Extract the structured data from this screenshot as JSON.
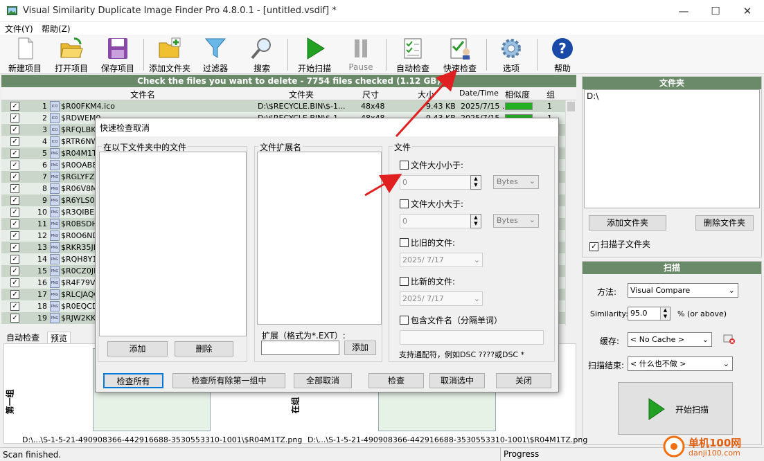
{
  "window": {
    "title": "Visual Similarity Duplicate Image Finder Pro 4.8.0.1 - [untitled.vsdif] *",
    "minimize": "—",
    "maximize": "☐",
    "close": "✕"
  },
  "menu": [
    "文件(Y)",
    "帮助(Z)"
  ],
  "toolbar": {
    "new": "新建项目",
    "open": "打开项目",
    "save": "保存项目",
    "add_folder": "添加文件夹",
    "filter": "过滤器",
    "search": "搜索",
    "start": "开始扫描",
    "pause": "Pause",
    "auto_check": "自动检查",
    "quick_check": "快速检查",
    "options": "选项",
    "help": "帮助"
  },
  "grid": {
    "banner": "Check the files you want to delete - 7754 files checked (1.12 GB)",
    "columns": [
      "文件名",
      "文件夹",
      "尺寸",
      "大小",
      "Date/Time",
      "相似度",
      "组"
    ],
    "rows": [
      {
        "n": "1",
        "name": "$R00FKM4.ico",
        "icon": "ICO",
        "folder": "D:\\$RECYCLE.BIN\\$-1...",
        "size": "48x48",
        "kb": "9.43 KB",
        "dt": "2025/7/15 ...",
        "sim": 100,
        "grp": "1"
      },
      {
        "n": "2",
        "name": "$RDWEM0...",
        "icon": "ICO",
        "folder": "D:\\$RECYCLE.BIN\\$-1...",
        "size": "48x48",
        "kb": "9.43 KB",
        "dt": "2025/7/15 ...",
        "sim": 100,
        "grp": "1"
      },
      {
        "n": "3",
        "name": "$RFQLBKF...",
        "icon": "ICO",
        "folder": "",
        "size": "",
        "kb": "",
        "dt": "",
        "sim": 0,
        "grp": ""
      },
      {
        "n": "4",
        "name": "$RTR6NW...",
        "icon": "ICO",
        "folder": "",
        "size": "",
        "kb": "",
        "dt": "",
        "sim": 0,
        "grp": ""
      },
      {
        "n": "5",
        "name": "$R04M1TZ...",
        "icon": "PNG",
        "folder": "",
        "size": "",
        "kb": "",
        "dt": "",
        "sim": 0,
        "grp": ""
      },
      {
        "n": "6",
        "name": "$R0OAB8X...",
        "icon": "PNG",
        "folder": "",
        "size": "",
        "kb": "",
        "dt": "",
        "sim": 0,
        "grp": ""
      },
      {
        "n": "7",
        "name": "$RGLYFZH...",
        "icon": "PNG",
        "folder": "",
        "size": "",
        "kb": "",
        "dt": "",
        "sim": 0,
        "grp": ""
      },
      {
        "n": "8",
        "name": "$R06V8M3...",
        "icon": "PNG",
        "folder": "",
        "size": "",
        "kb": "",
        "dt": "",
        "sim": 0,
        "grp": ""
      },
      {
        "n": "9",
        "name": "$R6YLS0Q...",
        "icon": "PNG",
        "folder": "",
        "size": "",
        "kb": "",
        "dt": "",
        "sim": 0,
        "grp": ""
      },
      {
        "n": "10",
        "name": "$R3QIBE2...",
        "icon": "PNG",
        "folder": "",
        "size": "",
        "kb": "",
        "dt": "",
        "sim": 0,
        "grp": ""
      },
      {
        "n": "11",
        "name": "$R0BSDH5...",
        "icon": "PNG",
        "folder": "",
        "size": "",
        "kb": "",
        "dt": "",
        "sim": 0,
        "grp": ""
      },
      {
        "n": "12",
        "name": "$R0O6ND8...",
        "icon": "PNG",
        "folder": "",
        "size": "",
        "kb": "",
        "dt": "",
        "sim": 0,
        "grp": ""
      },
      {
        "n": "13",
        "name": "$RKR35JK...",
        "icon": "PNG",
        "folder": "",
        "size": "",
        "kb": "",
        "dt": "",
        "sim": 0,
        "grp": ""
      },
      {
        "n": "14",
        "name": "$RQH8Y19...",
        "icon": "PNG",
        "folder": "",
        "size": "",
        "kb": "",
        "dt": "",
        "sim": 0,
        "grp": ""
      },
      {
        "n": "15",
        "name": "$R0CZ0JN...",
        "icon": "PNG",
        "folder": "",
        "size": "",
        "kb": "",
        "dt": "",
        "sim": 0,
        "grp": ""
      },
      {
        "n": "16",
        "name": "$R4F79VA...",
        "icon": "PNG",
        "folder": "",
        "size": "",
        "kb": "",
        "dt": "",
        "sim": 0,
        "grp": ""
      },
      {
        "n": "17",
        "name": "$RLCJAQQ...",
        "icon": "PNG",
        "folder": "",
        "size": "",
        "kb": "",
        "dt": "",
        "sim": 0,
        "grp": ""
      },
      {
        "n": "18",
        "name": "$R0EQCD1...",
        "icon": "PNG",
        "folder": "",
        "size": "",
        "kb": "",
        "dt": "",
        "sim": 0,
        "grp": ""
      },
      {
        "n": "19",
        "name": "$RJW2KKE...",
        "icon": "PNG",
        "folder": "",
        "size": "",
        "kb": "",
        "dt": "",
        "sim": 0,
        "grp": ""
      }
    ]
  },
  "lower": {
    "tab_auto": "自动检查",
    "tab_preview": "预览",
    "group_left": "第一组",
    "group_right": "在组",
    "path_left": "D:\\...\\S-1-5-21-490908366-442916688-3530553310-1001\\$R04M1TZ.png",
    "path_right": "D:\\...\\S-1-5-21-490908366-442916688-3530553310-1001\\$R04M1TZ.png"
  },
  "status": {
    "left": "Scan finished.",
    "progress": "Progress"
  },
  "folders_panel": {
    "title": "文件夹",
    "item": "D:\\",
    "add": "添加文件夹",
    "remove": "删除文件夹",
    "subfolders": "扫描子文件夹"
  },
  "scan_panel": {
    "title": "扫描",
    "method_label": "方法:",
    "method_value": "Visual Compare",
    "similarity_label": "Similarity:",
    "similarity_value": "95.0",
    "similarity_unit": "% (or above)",
    "cache_label": "缓存:",
    "cache_value": "< No Cache >",
    "end_label": "扫描结束:",
    "end_value": "< 什么也不做 >",
    "start": "开始扫描"
  },
  "dialog": {
    "title": "快速检查取消",
    "folders_group": "在以下文件夹中的文件",
    "ext_group": "文件扩展名",
    "ext_label": "扩展（格式为*.EXT）:",
    "add": "添加",
    "delete": "删除",
    "file_group": "文件",
    "size_less": "文件大小小于:",
    "size_less_value": "0",
    "size_greater": "文件大小大于:",
    "size_greater_value": "0",
    "unit": "Bytes",
    "older": "比旧的文件:",
    "older_date": "2025/ 7/17",
    "newer": "比新的文件:",
    "newer_date": "2025/ 7/17",
    "contains": "包含文件名（分隔单词）",
    "wildcard": "支持通配符，例如DSC ????或DSC *",
    "btn_check_all": "检查所有",
    "btn_check_all_but_first": "检查所有除第一组中",
    "btn_uncheck_all": "全部取消",
    "btn_check": "检查",
    "btn_uncheck_selected": "取消选中",
    "btn_close": "关闭"
  },
  "watermark": {
    "text": "单机100网",
    "url": "danji100.com"
  },
  "colors": {
    "header_green": "#6a8a6a",
    "row_a": "#c9d6c9",
    "row_b": "#e6ece6",
    "arrow": "#e02020"
  }
}
